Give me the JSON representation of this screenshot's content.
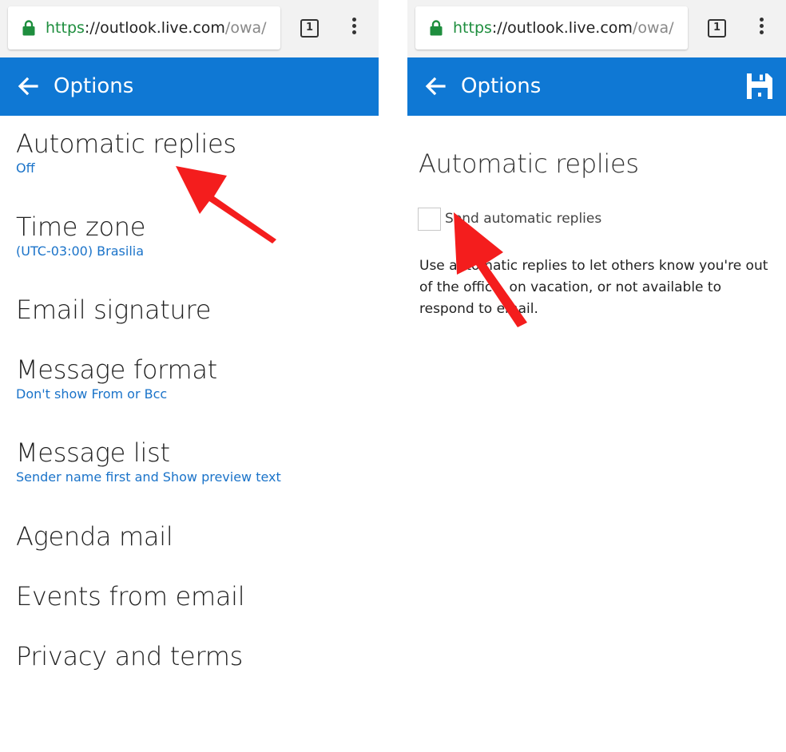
{
  "colors": {
    "header_blue": "#0f78d4",
    "link_blue": "#1a73c9",
    "https_green": "#1e8e3e",
    "arrow_red": "#f41d1d"
  },
  "browser": {
    "url_scheme": "https",
    "url_separator": "://",
    "url_host": "outlook.live.com",
    "url_path": "/owa/",
    "tab_count": "1",
    "lock_icon": "lock-icon",
    "menu_icon": "vertical-dots-icon"
  },
  "left": {
    "header": {
      "title": "Options",
      "back_icon": "back-arrow-icon"
    },
    "options": [
      {
        "title": "Automatic replies",
        "subtitle": "Off"
      },
      {
        "title": "Time zone",
        "subtitle": "(UTC-03:00) Brasilia"
      },
      {
        "title": "Email signature"
      },
      {
        "title": "Message format",
        "subtitle": "Don't show From or Bcc"
      },
      {
        "title": "Message list",
        "subtitle": "Sender name first and Show preview text"
      },
      {
        "title": "Agenda mail"
      },
      {
        "title": "Events from email"
      },
      {
        "title": "Privacy and terms"
      }
    ]
  },
  "right": {
    "header": {
      "title": "Options",
      "back_icon": "back-arrow-icon",
      "save_icon": "save-icon"
    },
    "section_title": "Automatic replies",
    "checkbox": {
      "label": "Send automatic replies",
      "checked": false
    },
    "description": "Use automatic replies to let others know you're out of the office, on vacation, or not available to respond to email."
  }
}
